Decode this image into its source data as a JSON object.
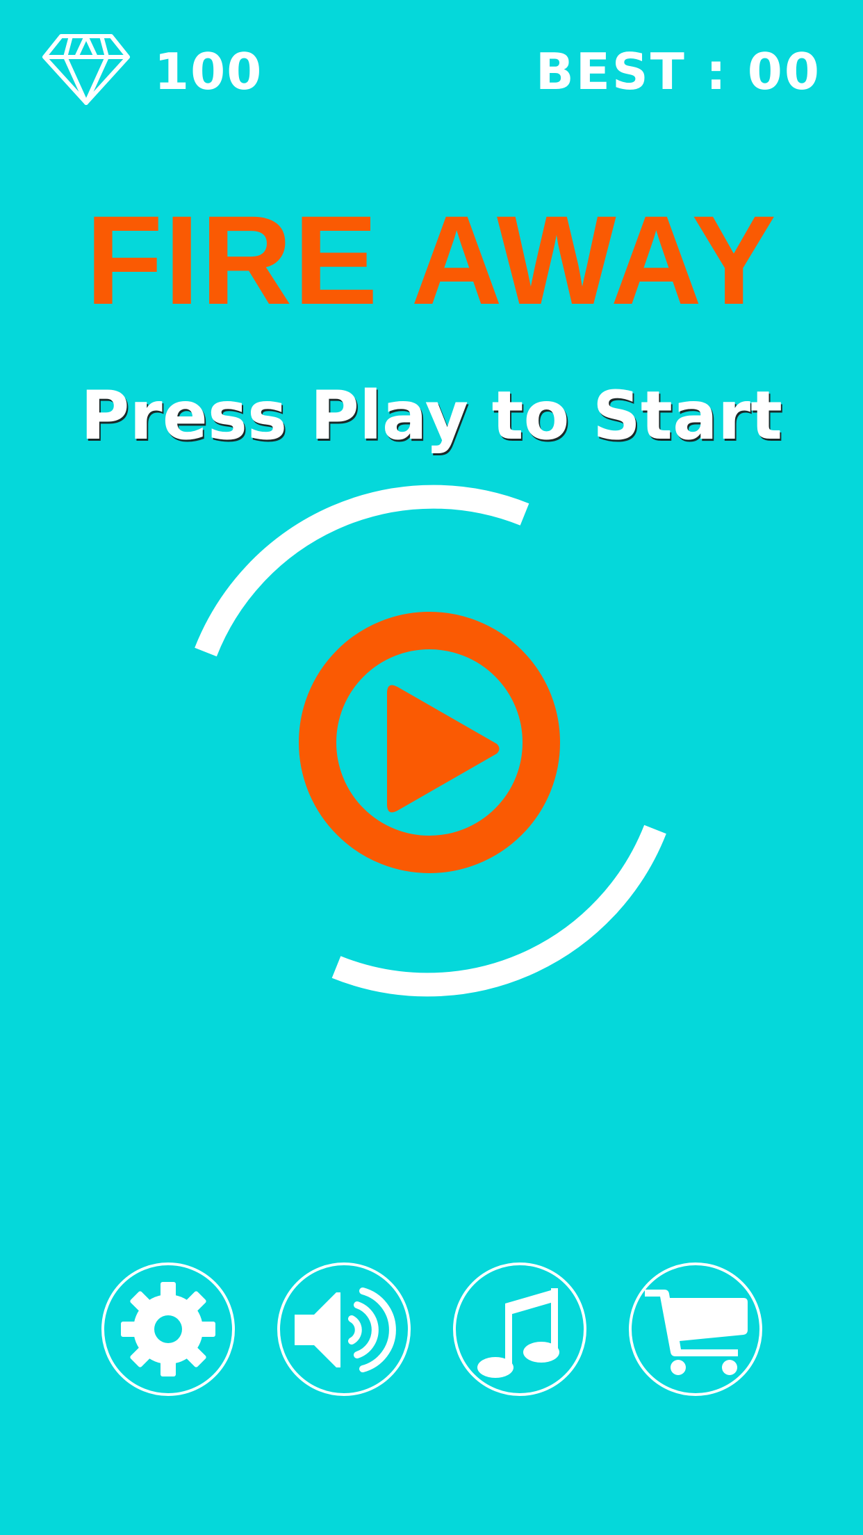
{
  "hud": {
    "gem_icon": "diamond-icon",
    "gems": "100",
    "best": "BEST : 00"
  },
  "title": "FIRE AWAY",
  "subtitle": "Press Play to Start",
  "play_button": {
    "icon": "play-icon"
  },
  "menu": [
    {
      "id": "settings",
      "icon": "gear-icon"
    },
    {
      "id": "sound",
      "icon": "speaker-icon"
    },
    {
      "id": "music",
      "icon": "music-note-icon"
    },
    {
      "id": "shop",
      "icon": "cart-icon"
    }
  ],
  "colors": {
    "background": "#05D8DA",
    "accent": "#FA5A03",
    "foreground": "#FFFFFF"
  }
}
